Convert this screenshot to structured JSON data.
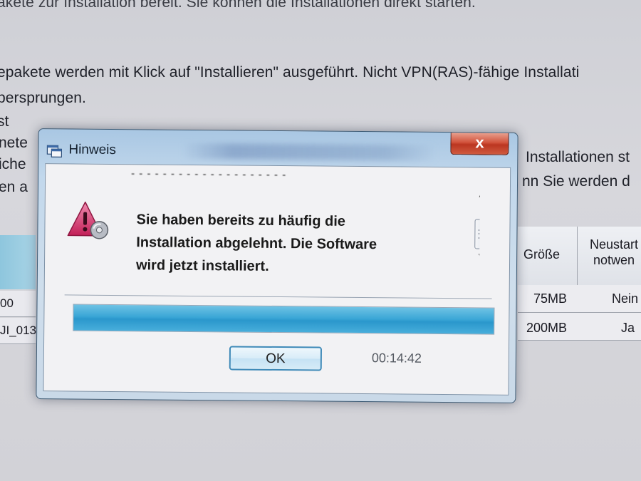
{
  "background": {
    "lines": [
      "akete zur Installation bereit. Sie können die Installationen direkt starten.",
      "epakete werden mit Klick auf \"Installieren\" ausgeführt. Nicht VPN(RAS)-fähige Installati",
      "bersprungen.",
      "st"
    ],
    "left_fragments": [
      "nete",
      "iche",
      "en a"
    ],
    "right_fragments": [
      "Installationen st",
      "nn Sie werden d"
    ],
    "table": {
      "columns": [
        "Größe",
        "Neustart notwen"
      ],
      "rows": [
        {
          "id": "00",
          "size": "75MB",
          "restart": "Nein"
        },
        {
          "id": "JI_013",
          "size": "200MB",
          "restart": "Ja"
        }
      ]
    }
  },
  "dialog": {
    "title": "Hinweis",
    "close_label": "x",
    "message": "Sie haben bereits zu häufig die\nInstallation abgelehnt. Die Software\nwird jetzt installiert.",
    "progress": 1.0,
    "ok_label": "OK",
    "timer": "00:14:42",
    "accent_colors": {
      "progress": "#3aa6d6",
      "close_button": "#c8412b",
      "warning_icon": "#c9285d"
    }
  }
}
